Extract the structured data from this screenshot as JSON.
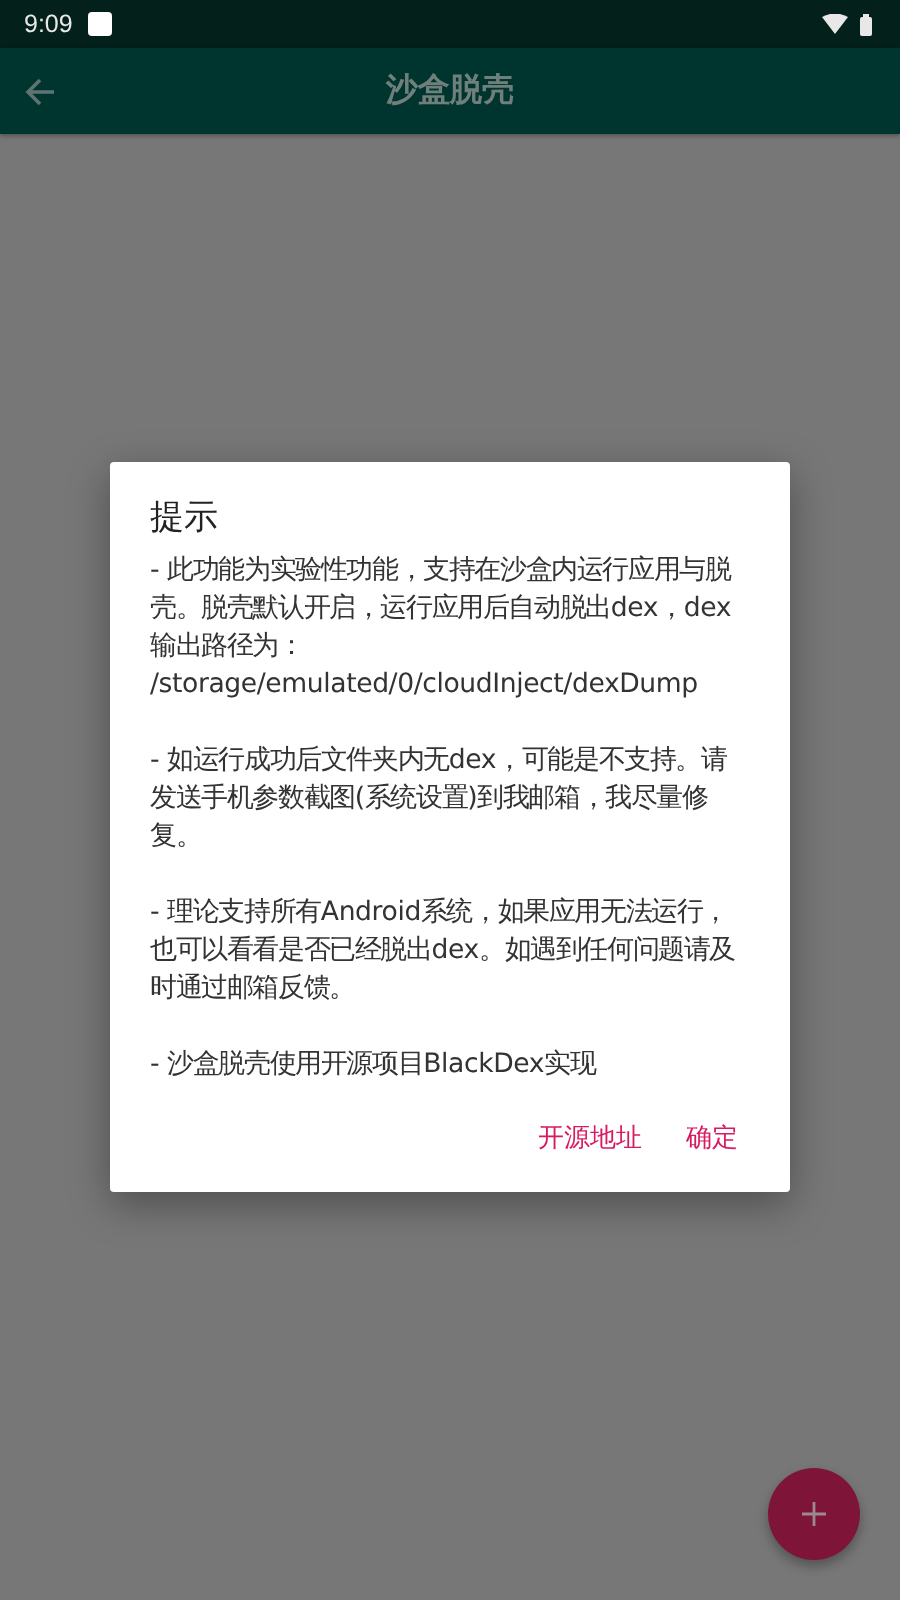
{
  "status_bar": {
    "time": "9:09"
  },
  "app_bar": {
    "title": "沙盒脱壳"
  },
  "dialog": {
    "title": "提示",
    "paragraphs": [
      "- 此功能为实验性功能，支持在沙盒内运行应用与脱壳。脱壳默认开启，运行应用后自动脱出dex，dex输出路径为：\n/storage/emulated/0/cloudInject/dexDump",
      "- 如运行成功后文件夹内无dex，可能是不支持。请发送手机参数截图(系统设置)到我邮箱，我尽量修复。",
      "- 理论支持所有Android系统，如果应用无法运行，也可以看看是否已经脱出dex。如遇到任何问题请及时通过邮箱反馈。",
      "- 沙盒脱壳使用开源项目BlackDex实现"
    ],
    "buttons": [
      "开源地址",
      "确定"
    ]
  }
}
